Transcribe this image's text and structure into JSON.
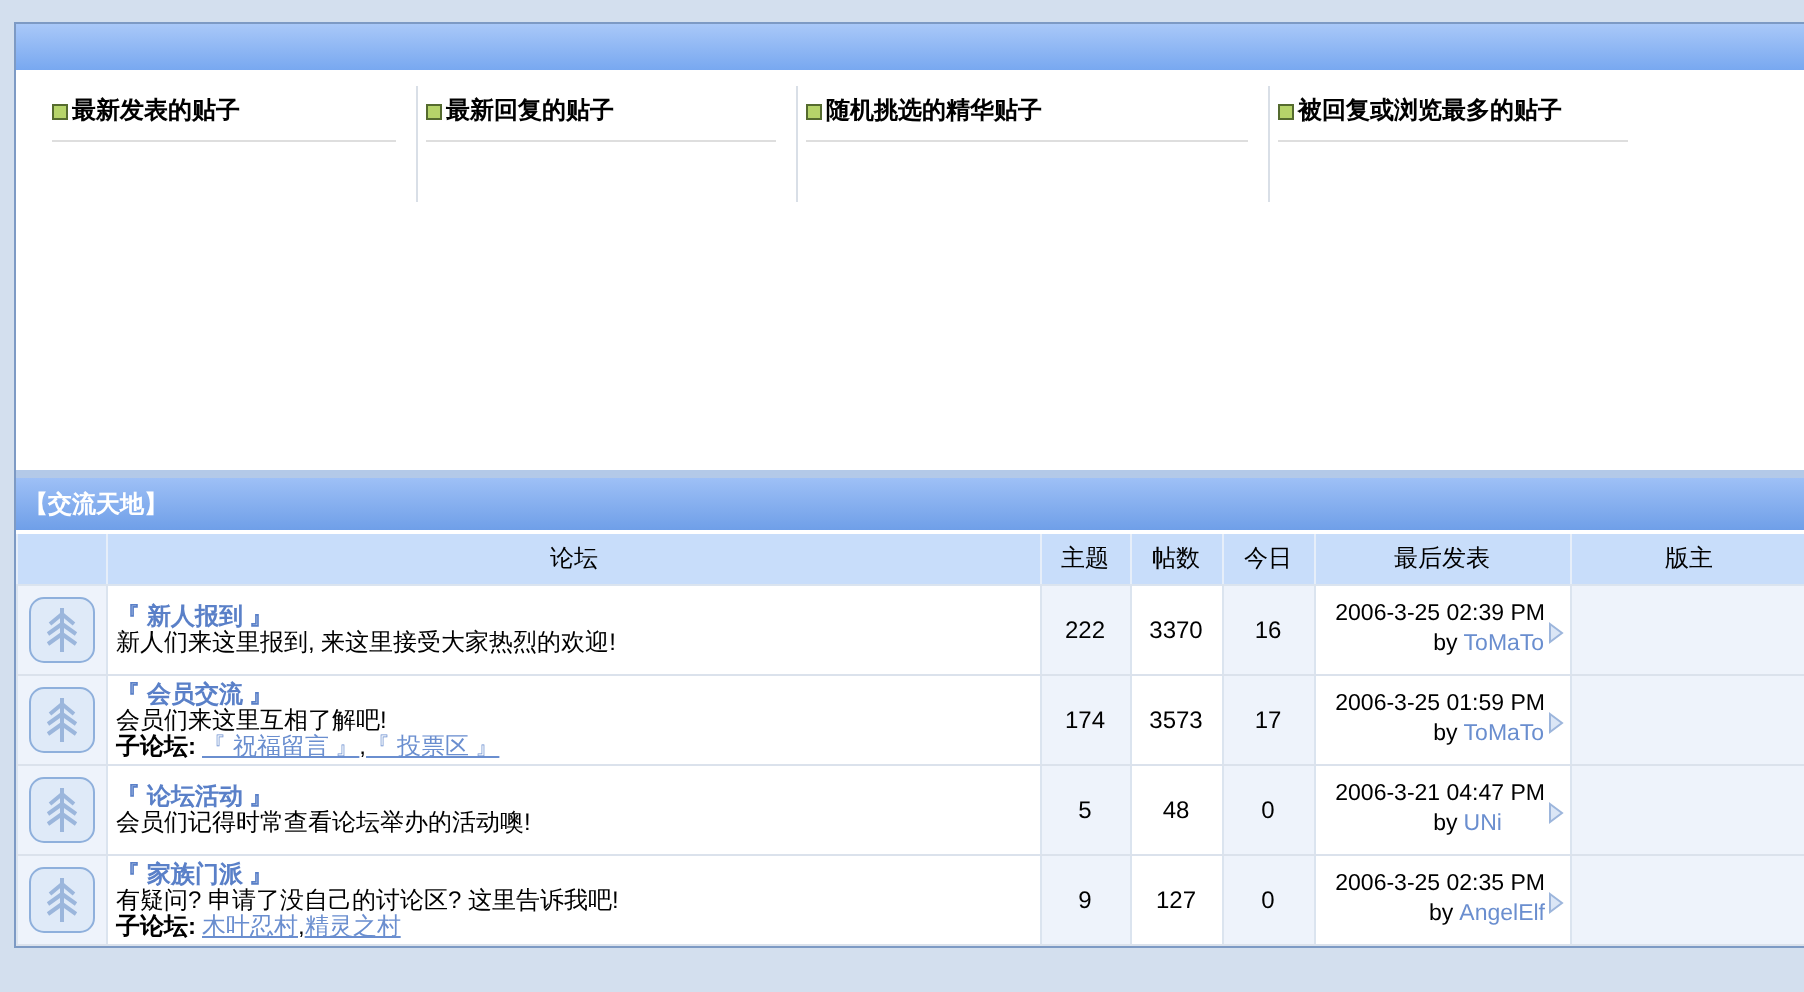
{
  "top_panel": {
    "columns": [
      {
        "title": "最新发表的贴子"
      },
      {
        "title": "最新回复的贴子"
      },
      {
        "title": "随机挑选的精华贴子"
      },
      {
        "title": "被回复或浏览最多的贴子"
      }
    ]
  },
  "category": {
    "title": "【交流天地】",
    "columns": [
      "论坛",
      "主题",
      "帖数",
      "今日",
      "最后发表",
      "版主"
    ],
    "rows": [
      {
        "name": "『 新人报到 』",
        "description": "新人们来这里报到, 来这里接受大家热烈的欢迎!",
        "topics": "222",
        "posts": "3370",
        "today": "16",
        "last_time": "2006-3-25 02:39 PM",
        "by": "by",
        "last_user": "ToMaTo"
      },
      {
        "name": "『 会员交流 』",
        "description": "会员们来这里互相了解吧!",
        "subforum_label": "子论坛:",
        "subforums": [
          "『 祝福留言 』",
          "『 投票区 』"
        ],
        "separator": ",",
        "topics": "174",
        "posts": "3573",
        "today": "17",
        "last_time": "2006-3-25 01:59 PM",
        "by": "by",
        "last_user": "ToMaTo"
      },
      {
        "name": "『 论坛活动 』",
        "description": "会员们记得时常查看论坛举办的活动噢!",
        "topics": "5",
        "posts": "48",
        "today": "0",
        "last_time": "2006-3-21 04:47 PM",
        "by": "by",
        "last_user": "UNi"
      },
      {
        "name": "『 家族门派 』",
        "description": "有疑问? 申请了没自己的讨论区? 这里告诉我吧!",
        "subforum_label": "子论坛:",
        "subforums": [
          "木叶忍村",
          "精灵之村"
        ],
        "separator": ",",
        "topics": "9",
        "posts": "127",
        "today": "0",
        "last_time": "2006-3-25 02:35 PM",
        "by": "by",
        "last_user": "AngelElf"
      }
    ]
  }
}
